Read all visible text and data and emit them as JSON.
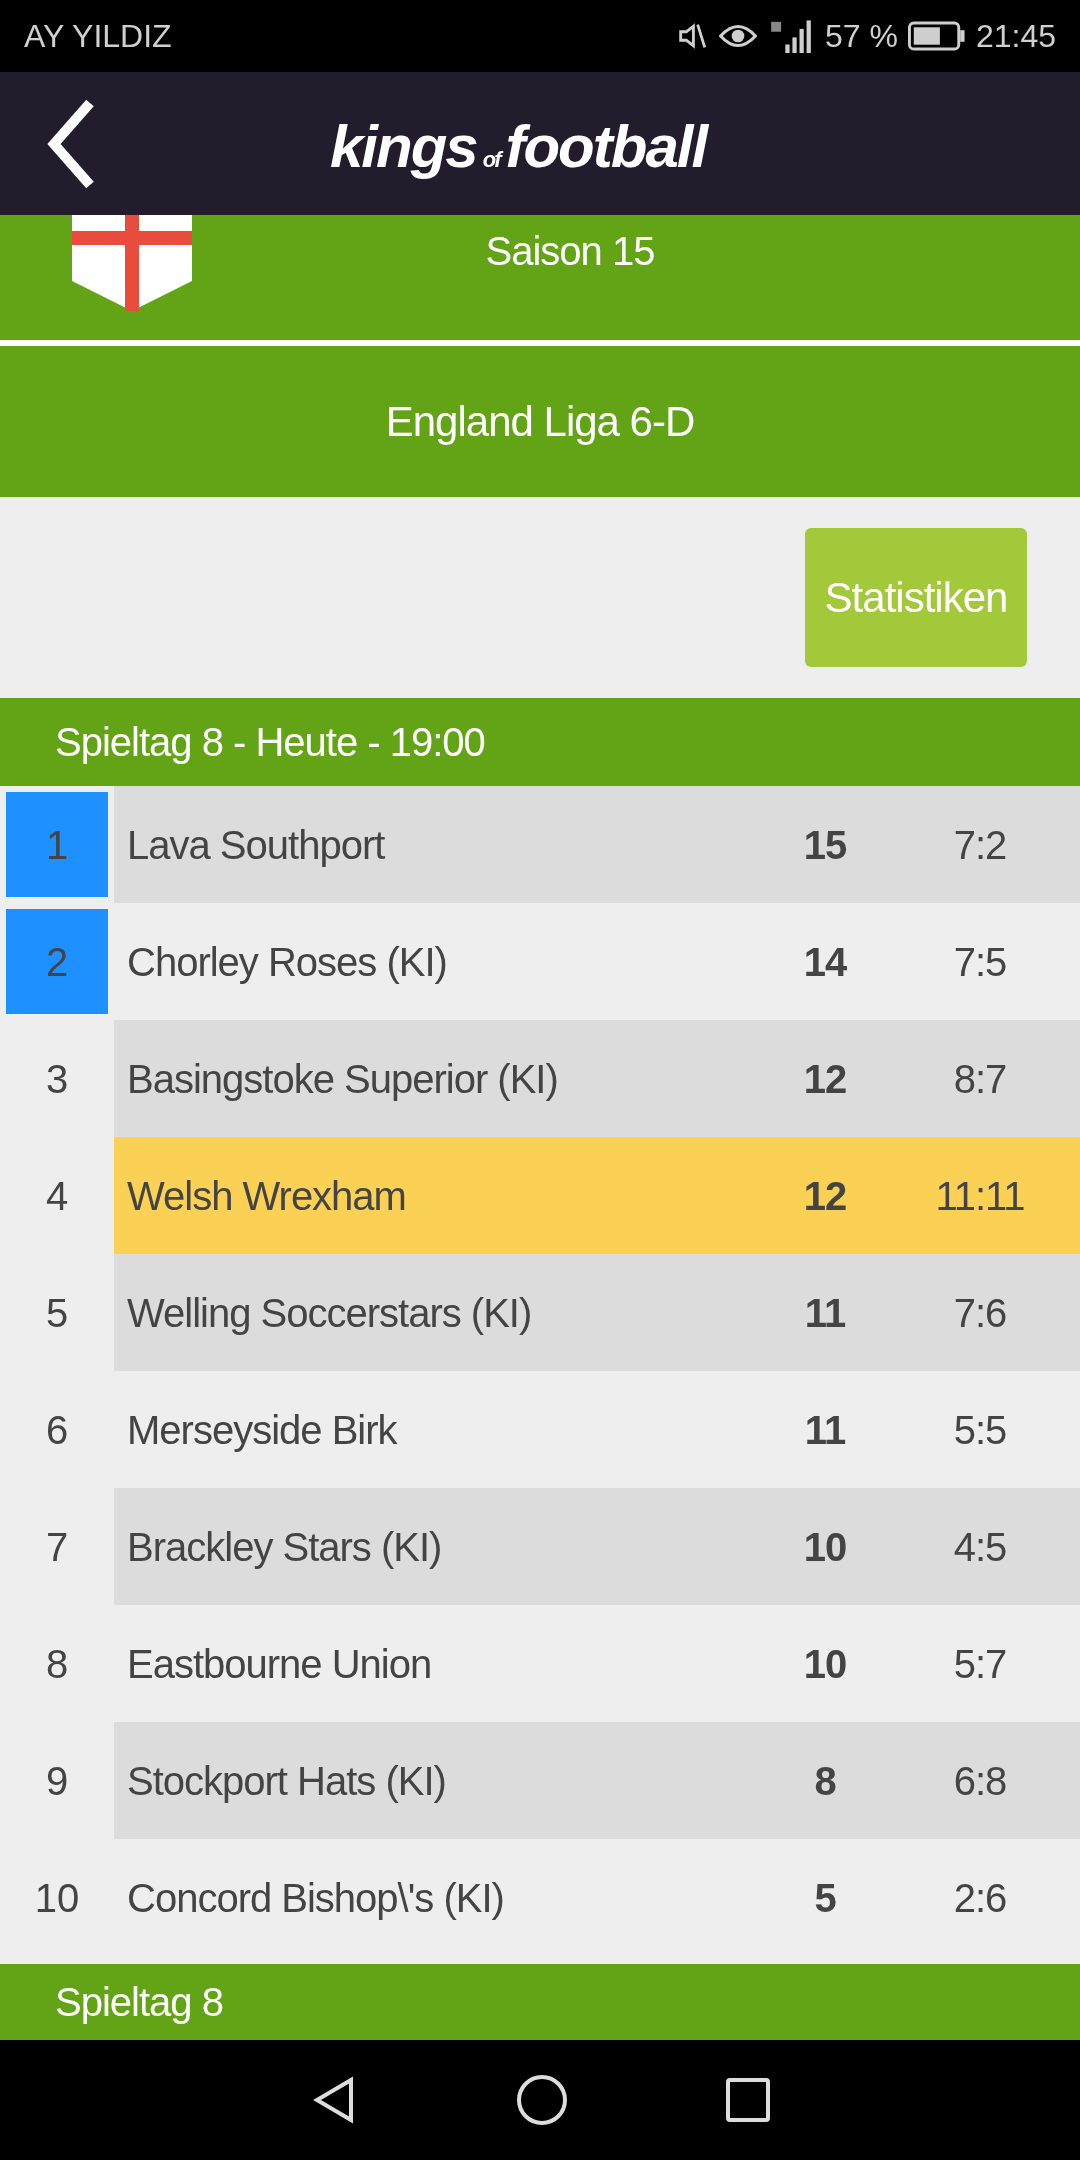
{
  "status_bar": {
    "carrier": "AY YILDIZ",
    "battery": "57 %",
    "time": "21:45"
  },
  "header": {
    "logo_main": "kings",
    "logo_small": "of",
    "logo_end": "football"
  },
  "season": "Saison 15",
  "league": "England Liga 6-D",
  "stats_button": "Statistiken",
  "matchday": "Spieltag 8 - Heute - 19:00",
  "rows": [
    {
      "rank": "1",
      "team": "Lava Southport",
      "points": "15",
      "goals": "7:2",
      "promoted": true,
      "own_team": false
    },
    {
      "rank": "2",
      "team": "Chorley Roses (KI)",
      "points": "14",
      "goals": "7:5",
      "promoted": true,
      "own_team": false
    },
    {
      "rank": "3",
      "team": "Basingstoke Superior (KI)",
      "points": "12",
      "goals": "8:7",
      "promoted": false,
      "own_team": false
    },
    {
      "rank": "4",
      "team": "Welsh Wrexham",
      "points": "12",
      "goals": "11:11",
      "promoted": false,
      "own_team": true
    },
    {
      "rank": "5",
      "team": "Welling Soccerstars (KI)",
      "points": "11",
      "goals": "7:6",
      "promoted": false,
      "own_team": false
    },
    {
      "rank": "6",
      "team": "Merseyside Birk",
      "points": "11",
      "goals": "5:5",
      "promoted": false,
      "own_team": false
    },
    {
      "rank": "7",
      "team": "Brackley Stars (KI)",
      "points": "10",
      "goals": "4:5",
      "promoted": false,
      "own_team": false
    },
    {
      "rank": "8",
      "team": "Eastbourne Union",
      "points": "10",
      "goals": "5:7",
      "promoted": false,
      "own_team": false
    },
    {
      "rank": "9",
      "team": "Stockport Hats (KI)",
      "points": "8",
      "goals": "6:8",
      "promoted": false,
      "own_team": false
    },
    {
      "rank": "10",
      "team": "Concord Bishop\\'s (KI)",
      "points": "5",
      "goals": "2:6",
      "promoted": false,
      "own_team": false
    }
  ],
  "next_section": "Spieltag 8"
}
